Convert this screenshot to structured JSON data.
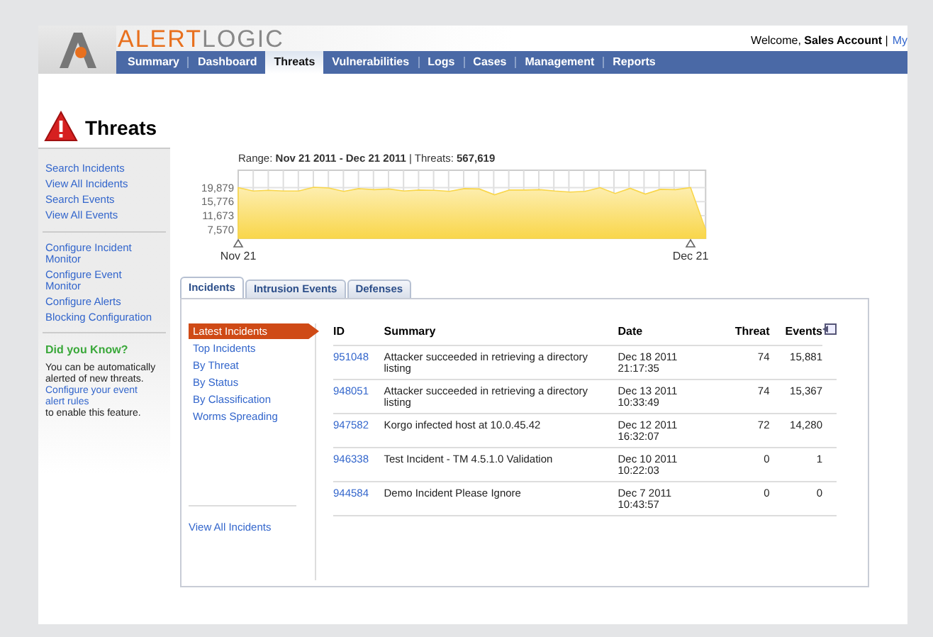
{
  "header": {
    "logo_text_1": "ALERT",
    "logo_text_2": "LOGIC",
    "welcome": "Welcome, **Sales Account** |",
    "account_link": "My"
  },
  "nav": [
    {
      "label": "Summary",
      "selected": false
    },
    {
      "label": "Dashboard",
      "selected": false
    },
    {
      "label": "Threats",
      "selected": true
    },
    {
      "label": "Vulnerabilities",
      "selected": false
    },
    {
      "label": "Logs",
      "selected": false
    },
    {
      "label": "Cases",
      "selected": false
    },
    {
      "label": "Management",
      "selected": false
    },
    {
      "label": "Reports",
      "selected": false
    }
  ],
  "page_title": "Threats",
  "sidebar": {
    "groups": [
      [
        "Search Incidents",
        "View All Incidents",
        "Search Events",
        "View All Events"
      ],
      [
        "Configure Incident Monitor",
        "Configure Event Monitor",
        "Configure Alerts",
        "Blocking Configuration"
      ]
    ],
    "tip_title": "Did you Know?",
    "tip_before": "You can be automatically alerted of new threats.",
    "tip_link": "Configure your event alert rules",
    "tip_after": "to enable this feature."
  },
  "range_text": "Range: **Nov 21 2011 - Dec 21 2011** | Threats:  **567,619**",
  "chart_data": {
    "type": "area",
    "grid": true,
    "categories": [
      "Nov 21",
      null,
      null,
      null,
      null,
      null,
      null,
      null,
      null,
      null,
      null,
      null,
      null,
      null,
      null,
      null,
      null,
      null,
      null,
      null,
      null,
      null,
      null,
      null,
      null,
      null,
      null,
      null,
      null,
      null,
      "Dec 21",
      null
    ],
    "series": [
      {
        "color": "#f9d64a",
        "values": [
          19900,
          18900,
          19100,
          18900,
          18900,
          20000,
          19800,
          18800,
          19600,
          19300,
          19500,
          18900,
          19200,
          19100,
          18800,
          19600,
          19500,
          17800,
          19200,
          19200,
          19300,
          18900,
          18600,
          18800,
          19900,
          18200,
          19700,
          18000,
          19400,
          19300,
          19900,
          7600
        ]
      }
    ],
    "ylim": [
      5000,
      25000
    ],
    "yticks": [
      {
        "value": 19879,
        "label": "19,879"
      },
      {
        "value": 15776,
        "label": "15,776"
      },
      {
        "value": 11673,
        "label": "11,673"
      },
      {
        "value": 7570,
        "label": "7,570"
      }
    ]
  },
  "tabs": [
    {
      "label": "Incidents",
      "selected": true
    },
    {
      "label": "Intrusion Events",
      "selected": false
    },
    {
      "label": "Defenses",
      "selected": false
    }
  ],
  "incident_menu": [
    {
      "label": "Latest Incidents",
      "selected": true
    },
    {
      "label": "Top Incidents",
      "selected": false
    },
    {
      "label": "By Threat",
      "selected": false
    },
    {
      "label": "By Status",
      "selected": false
    },
    {
      "label": "By Classification",
      "selected": false
    },
    {
      "label": "Worms Spreading",
      "selected": false
    }
  ],
  "view_all_link": "View All Incidents",
  "table": {
    "columns": [
      "ID",
      "Summary",
      "Date",
      "Threat",
      "Events"
    ],
    "rows": [
      [
        "951048",
        "Attacker succeeded in retrieving a directory listing",
        "Dec 18 2011 21:17:35",
        "74",
        "15,881"
      ],
      [
        "948051",
        "Attacker succeeded in retrieving a directory listing",
        "Dec 13 2011 10:33:49",
        "74",
        "15,367"
      ],
      [
        "947582",
        "Korgo infected host at 10.0.45.42",
        "Dec 12 2011 16:32:07",
        "72",
        "14,280"
      ],
      [
        "946338",
        "Test Incident - TM 4.5.1.0 Validation",
        "Dec 10 2011 10:22:03",
        "0",
        "1"
      ],
      [
        "944584",
        "Demo Incident Please Ignore",
        "Dec 7 2011 10:43:57",
        "0",
        "0"
      ]
    ]
  }
}
